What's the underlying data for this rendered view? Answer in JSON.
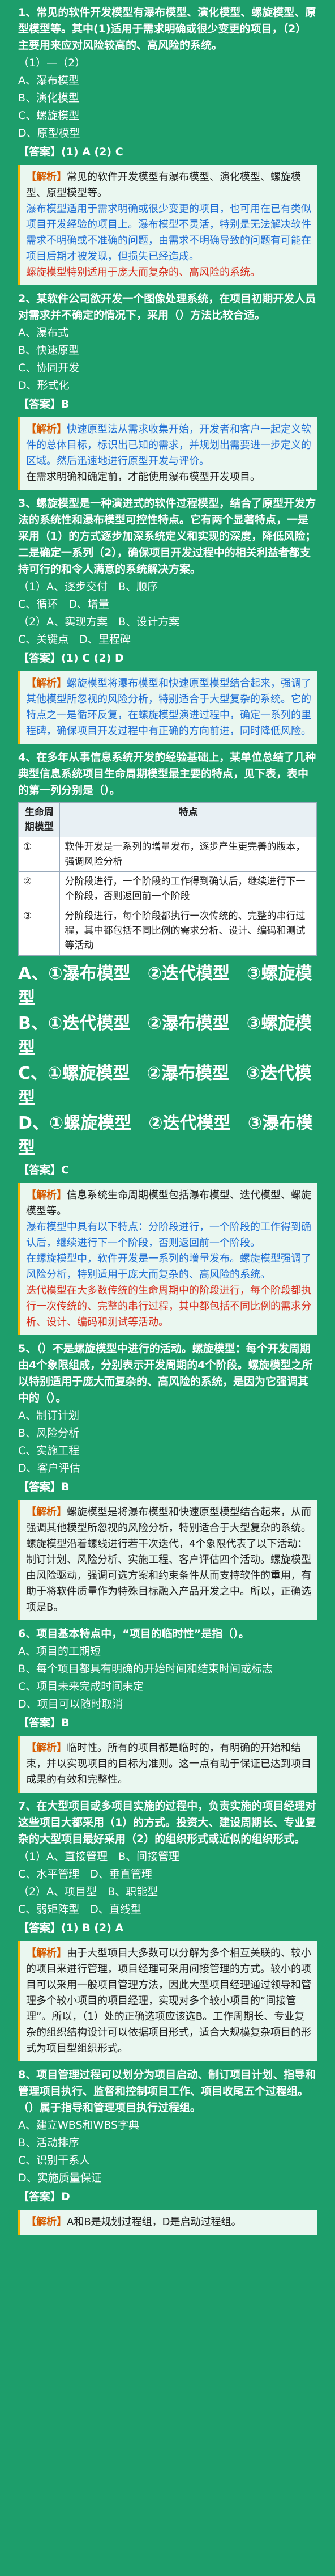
{
  "q1": {
    "title": "1、常见的软件开发模型有瀑布模型、演化模型、螺旋模型、原型模型等。其中(1)适用于需求明确或很少变更的项目，（2）主要用来应对风险较高的、高风险的系统。",
    "sub": "（1）—（2）",
    "options": [
      "A、瀑布模型",
      "B、演化模型",
      "C、螺旋模型",
      "D、原型模型"
    ],
    "answer": "【答案】(1) A (2) C",
    "analysis_label": "【解析】",
    "analysis": "常见的软件开发模型有瀑布模型、演化模型、螺旋模型、原型模型等。",
    "analysis2": "瀑布模型适用于需求明确或很少变更的项目，也可用在已有类似项目开发经验的项目上。瀑布模型不灵活，特别是无法解决软件需求不明确或不准确的问题，由需求不明确导致的问题有可能在项目后期才被发现，但损失已经造成。",
    "analysis3": "螺旋模型特别适用于庞大而复杂的、高风险的系统。"
  },
  "q2": {
    "title": "2、某软件公司欲开发一个图像处理系统，在项目初期开发人员对需求并不确定的情况下，采用（）方法比较合适。",
    "options": [
      "A、瀑布式",
      "B、快速原型",
      "C、协同开发",
      "D、形式化"
    ],
    "answer": "【答案】B",
    "analysis_label": "【解析】",
    "analysis": "快速原型法从需求收集开始，开发者和客户一起定义软件的总体目标，标识出已知的需求，并规划出需要进一步定义的区域。然后迅速地进行原型开发与评价。",
    "analysis2": "在需求明确和确定前，才能使用瀑布模型开发项目。"
  },
  "q3": {
    "title": "3、螺旋模型是一种演进式的软件过程模型，结合了原型开发方法的系统性和瀑布模型可控性特点。它有两个显著特点，一是采用（1）的方式逐步加深系统定义和实现的深度，降低风险；二是确定一系列（2），确保项目开发过程中的相关利益者都支持可行的和令人满意的系统解决方案。",
    "sub": "（1）A、逐步交付　B、顺序",
    "sub2": "C、循环　D、增量",
    "sub3": "（2）A、实现方案　B、设计方案",
    "sub4": "C、关键点　D、里程碑",
    "answer": "【答案】(1) C (2) D",
    "analysis_label": "【解析】",
    "analysis": "螺旋模型将瀑布模型和快速原型模型结合起来，强调了其他模型所忽视的风险分析，特别适合于大型复杂的系统。它的特点之一是循环反复，在螺旋模型演进过程中，确定一系列的里程碑，确保项目开发过程中有正确的方向前进，同时降低风险。"
  },
  "q4": {
    "title": "4、在多年从事信息系统开发的经验基础上，某单位总结了几种典型信息系统项目生命周期模型最主要的特点，见下表，表中的第一列分别是（）。",
    "table_head": [
      "生命周期模型",
      "特点"
    ],
    "table_rows": [
      [
        "①",
        "软件开发是一系列的增量发布，逐步产生更完善的版本，强调风险分析"
      ],
      [
        "②",
        "分阶段进行，一个阶段的工作得到确认后，继续进行下一个阶段，否则返回前一个阶段"
      ],
      [
        "③",
        "分阶段进行，每个阶段都执行一次传统的、完整的串行过程，其中都包括不同比例的需求分析、设计、编码和测试等活动"
      ]
    ],
    "opt_a": "A、①瀑布模型　②迭代模型　③螺旋模型",
    "opt_b": "B、①迭代模型　②瀑布模型　③螺旋模型",
    "opt_c": "C、①螺旋模型　②瀑布模型　③迭代模型",
    "opt_d": "D、①螺旋模型　②迭代模型　③瀑布模型",
    "answer": "【答案】C",
    "analysis_label": "【解析】",
    "analysis": "信息系统生命周期模型包括瀑布模型、迭代模型、螺旋模型等。",
    "analysis2": "瀑布模型中具有以下特点：分阶段进行，一个阶段的工作得到确认后，继续进行下一个阶段，否则返回前一个阶段。",
    "analysis3": "在螺旋模型中，软件开发是一系列的增量发布。螺旋模型强调了风险分析，特别适用于庞大而复杂的、高风险的系统。",
    "analysis4": "迭代模型在大多数传统的生命周期中的阶段进行，每个阶段都执行一次传统的、完整的串行过程，其中都包括不同比例的需求分析、设计、编码和测试等活动。"
  },
  "q5": {
    "title": "5、（）不是螺旋模型中进行的活动。螺旋模型：每个开发周期由4个象限组成，分别表示开发周期的4个阶段。螺旋模型之所以特别适用于庞大而复杂的、高风险的系统，是因为它强调其中的（）。",
    "options": [
      "A、制订计划",
      "B、风险分析",
      "C、实施工程",
      "D、客户评估"
    ],
    "answer": "【答案】B",
    "analysis_label": "【解析】",
    "analysis": "螺旋模型是将瀑布模型和快速原型模型结合起来，从而强调其他模型所忽视的风险分析，特别适合于大型复杂的系统。螺旋模型沿着螺线进行若干次迭代，4个象限代表了以下活动：制订计划、风险分析、实施工程、客户评估四个活动。螺旋模型由风险驱动，强调可选方案和约束条件从而支持软件的重用，有助于将软件质量作为特殊目标融入产品开发之中。所以，正确选项是B。"
  },
  "q6": {
    "title": "6、项目基本特点中，“项目的临时性”是指（）。",
    "options": [
      "A、项目的工期短",
      "B、每个项目都具有明确的开始时间和结束时间或标志",
      "C、项目未来完成时间未定",
      "D、项目可以随时取消"
    ],
    "answer": "【答案】B",
    "analysis_label": "【解析】",
    "analysis": "临时性。所有的项目都是临时的，有明确的开始和结束，并以实现项目的目标为准则。这一点有助于保证已达到项目成果的有效和完整性。"
  },
  "q7": {
    "title": "7、在大型项目或多项目实施的过程中，负责实施的项目经理对这些项目大都采用（1）的方式。投资大、建设周期长、专业复杂的大型项目最好采用（2）的组织形式或近似的组织形式。",
    "sub": "（1）A、直接管理　B、间接管理",
    "sub2": "C、水平管理　D、垂直管理",
    "sub3": "（2）A、项目型　B、职能型",
    "sub4": "C、弱矩阵型　D、直线型",
    "answer": "【答案】(1) B (2) A",
    "analysis_label": "【解析】",
    "analysis": "由于大型项目大多数可以分解为多个相互关联的、较小的项目来进行管理，项目经理可采用间接管理的方式。较小的项目可以采用一般项目管理方法，因此大型项目经理通过领导和管理多个较小项目的项目经理，实现对多个较小项目的“间接管理”。所以，（1）处的正确选项应该选B。工作周期长、专业复杂的组织结构设计可以依据项目形式，适合大规模复杂项目的形式为项目型组织形式。"
  },
  "q8": {
    "title": "8、项目管理过程可以划分为项目启动、制订项目计划、指导和管理项目执行、监督和控制项目工作、项目收尾五个过程组。（）属于指导和管理项目执行过程组。",
    "options": [
      "A、建立WBS和WBS字典",
      "B、活动排序",
      "C、识别干系人",
      "D、实施质量保证"
    ],
    "answer": "【答案】D",
    "analysis_label": "【解析】",
    "analysis": "A和B是规划过程组，D是启动过程组。"
  }
}
